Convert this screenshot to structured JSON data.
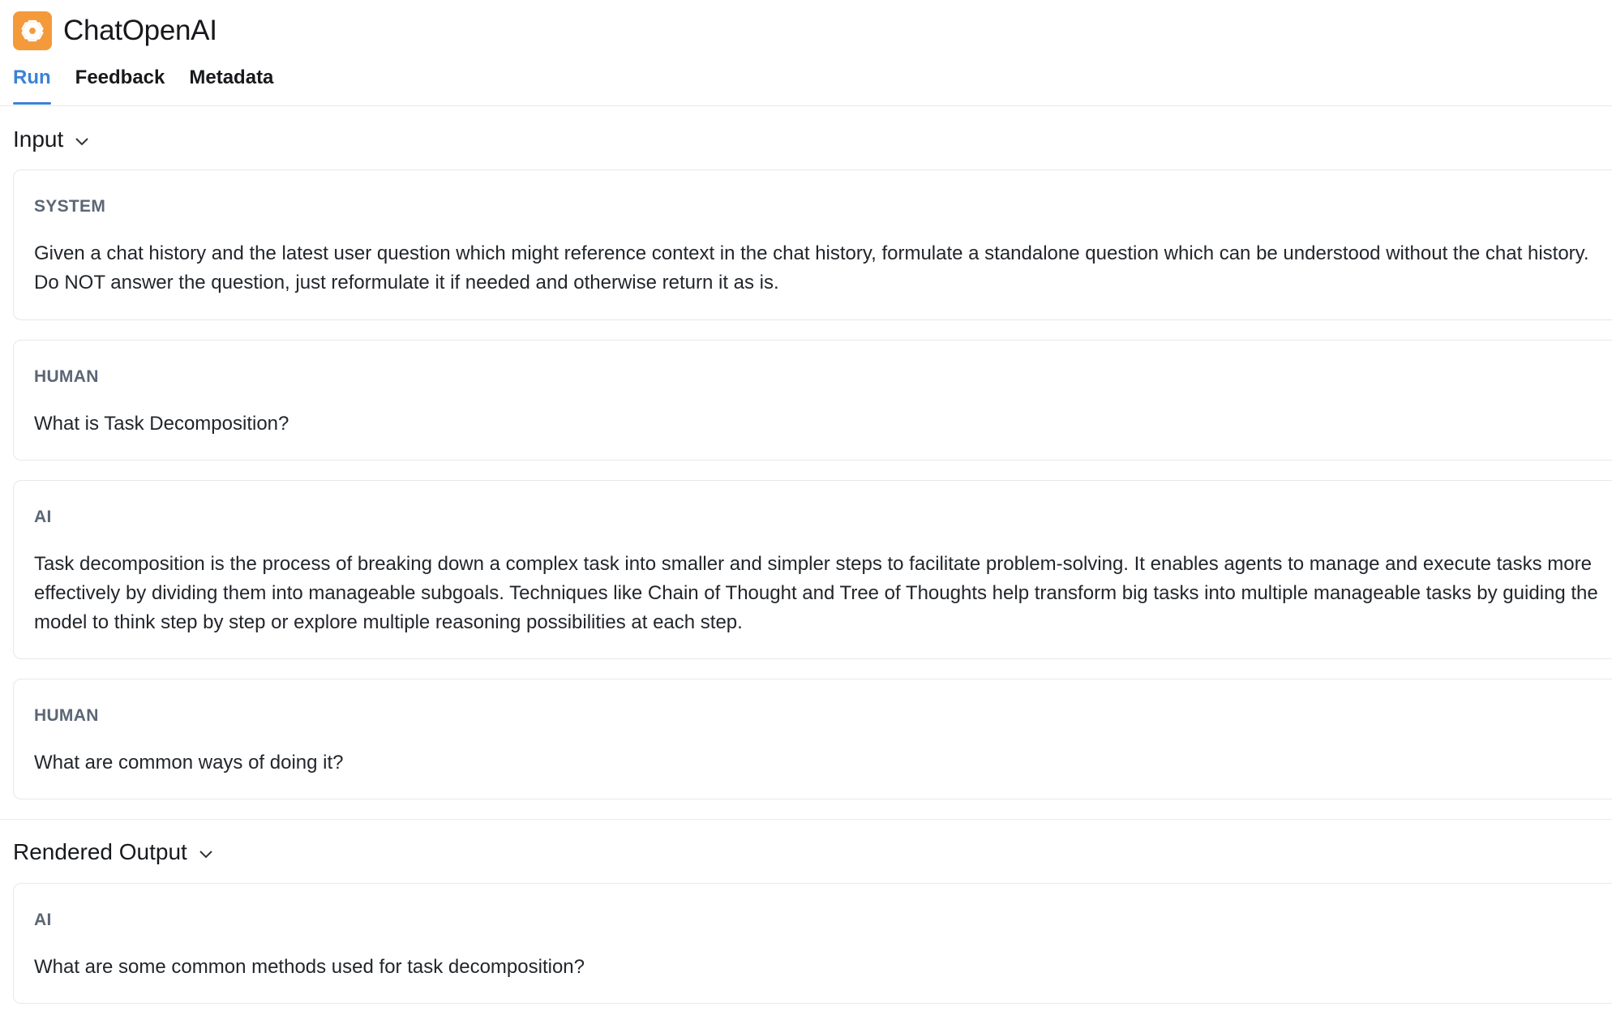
{
  "header": {
    "app_title": "ChatOpenAI",
    "logo_icon": "openai-logo-icon",
    "logo_color": "#f59a3a"
  },
  "tabs": [
    {
      "label": "Run",
      "active": true
    },
    {
      "label": "Feedback",
      "active": false
    },
    {
      "label": "Metadata",
      "active": false
    }
  ],
  "accent_color": "#3b82d6",
  "input": {
    "heading": "Input",
    "messages": [
      {
        "role": "SYSTEM",
        "content": "Given a chat history and the latest user question which might reference context in the chat history, formulate a standalone question which can be understood without the chat history. Do NOT answer the question, just reformulate it if needed and otherwise return it as is."
      },
      {
        "role": "HUMAN",
        "content": "What is Task Decomposition?"
      },
      {
        "role": "AI",
        "content": "Task decomposition is the process of breaking down a complex task into smaller and simpler steps to facilitate problem-solving. It enables agents to manage and execute tasks more effectively by dividing them into manageable subgoals. Techniques like Chain of Thought and Tree of Thoughts help transform big tasks into multiple manageable tasks by guiding the model to think step by step or explore multiple reasoning possibilities at each step."
      },
      {
        "role": "HUMAN",
        "content": "What are common ways of doing it?"
      }
    ]
  },
  "output": {
    "heading": "Rendered Output",
    "messages": [
      {
        "role": "AI",
        "content": "What are some common methods used for task decomposition?"
      }
    ]
  }
}
